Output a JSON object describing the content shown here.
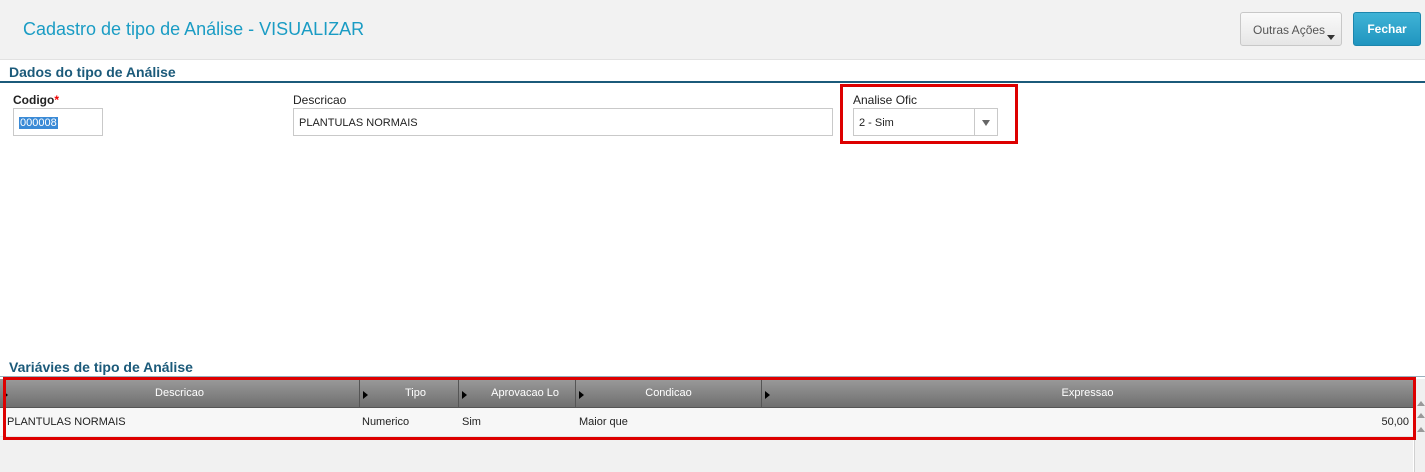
{
  "header": {
    "title": "Cadastro de tipo de Análise - VISUALIZAR",
    "other_actions_label": "Outras Ações",
    "close_label": "Fechar"
  },
  "form": {
    "section_title": "Dados do tipo de Análise",
    "codigo": {
      "label": "Codigo",
      "required_mark": "*",
      "value": "000008"
    },
    "descricao": {
      "label": "Descricao",
      "value": "PLANTULAS NORMAIS"
    },
    "analise_ofic": {
      "label": "Analise Ofic",
      "value": "2 - Sim"
    }
  },
  "variables": {
    "section_title": "Variávies de tipo de Análise",
    "columns": [
      "Descricao",
      "Tipo",
      "Aprovacao Lo",
      "Condicao",
      "Expressao"
    ],
    "rows": [
      [
        "PLANTULAS NORMAIS",
        "Numerico",
        "Sim",
        "Maior que",
        "50,00"
      ]
    ]
  },
  "colors": {
    "title": "#1a9cc4",
    "section": "#1b5a7a",
    "primary_button": "#2a9fcb",
    "highlight": "#dd0000"
  }
}
